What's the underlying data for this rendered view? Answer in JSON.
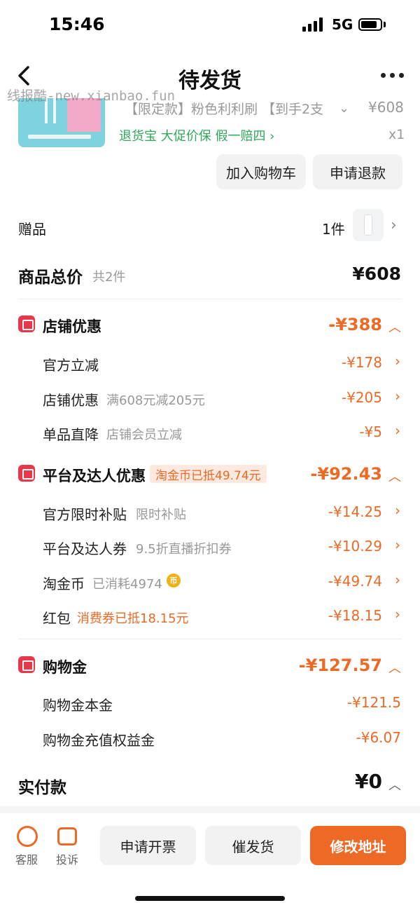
{
  "status": {
    "time": "15:46",
    "network": "5G"
  },
  "nav": {
    "title": "待发货"
  },
  "watermark": "线报酷-new.xianbao.fun",
  "product": {
    "title": "【限定款】粉色利利刷 【到手2支",
    "price": "¥608",
    "tags": "退货宝  大促价保  假一赔四 ›",
    "quantity": "x1",
    "buttons": {
      "add_cart": "加入购物车",
      "refund": "申请退款"
    }
  },
  "gift": {
    "label": "赠品",
    "count": "1件"
  },
  "total": {
    "label": "商品总价",
    "sub": "共2件",
    "value": "¥608"
  },
  "store_discount": {
    "title": "店铺优惠",
    "value": "-¥388",
    "rows": [
      {
        "label": "官方立减",
        "sub": "",
        "value": "-¥178"
      },
      {
        "label": "店铺优惠",
        "sub": "满608元减205元",
        "value": "-¥205"
      },
      {
        "label": "单品直降",
        "sub": "店铺会员立减",
        "value": "-¥5"
      }
    ]
  },
  "platform_discount": {
    "title": "平台及达人优惠",
    "badge": "淘金币已抵49.74元",
    "value": "-¥92.43",
    "rows": [
      {
        "label": "官方限时补贴",
        "sub": "限时补贴",
        "value": "-¥14.25"
      },
      {
        "label": "平台及达人券",
        "sub": "9.5折直播折扣券",
        "value": "-¥10.29"
      },
      {
        "label": "淘金币",
        "sub": "已消耗4974",
        "coin": "币",
        "value": "-¥49.74"
      },
      {
        "label": "红包",
        "sub": "消费券已抵18.15元",
        "value": "-¥18.15"
      }
    ]
  },
  "shopping_money": {
    "title": "购物金",
    "value": "-¥127.57",
    "rows": [
      {
        "label": "购物金本金",
        "value": "-¥121.5"
      },
      {
        "label": "购物金充值权益金",
        "value": "-¥6.07"
      }
    ]
  },
  "payment": {
    "label": "实付款",
    "value": "¥0"
  },
  "bottom": {
    "service": "客服",
    "complain": "投诉",
    "invoice": "申请开票",
    "urge": "催发货",
    "modify_address": "修改地址"
  },
  "colors": {
    "accent": "#ec6a26",
    "green": "#2fa85a",
    "icon_red": "#e8374a"
  }
}
